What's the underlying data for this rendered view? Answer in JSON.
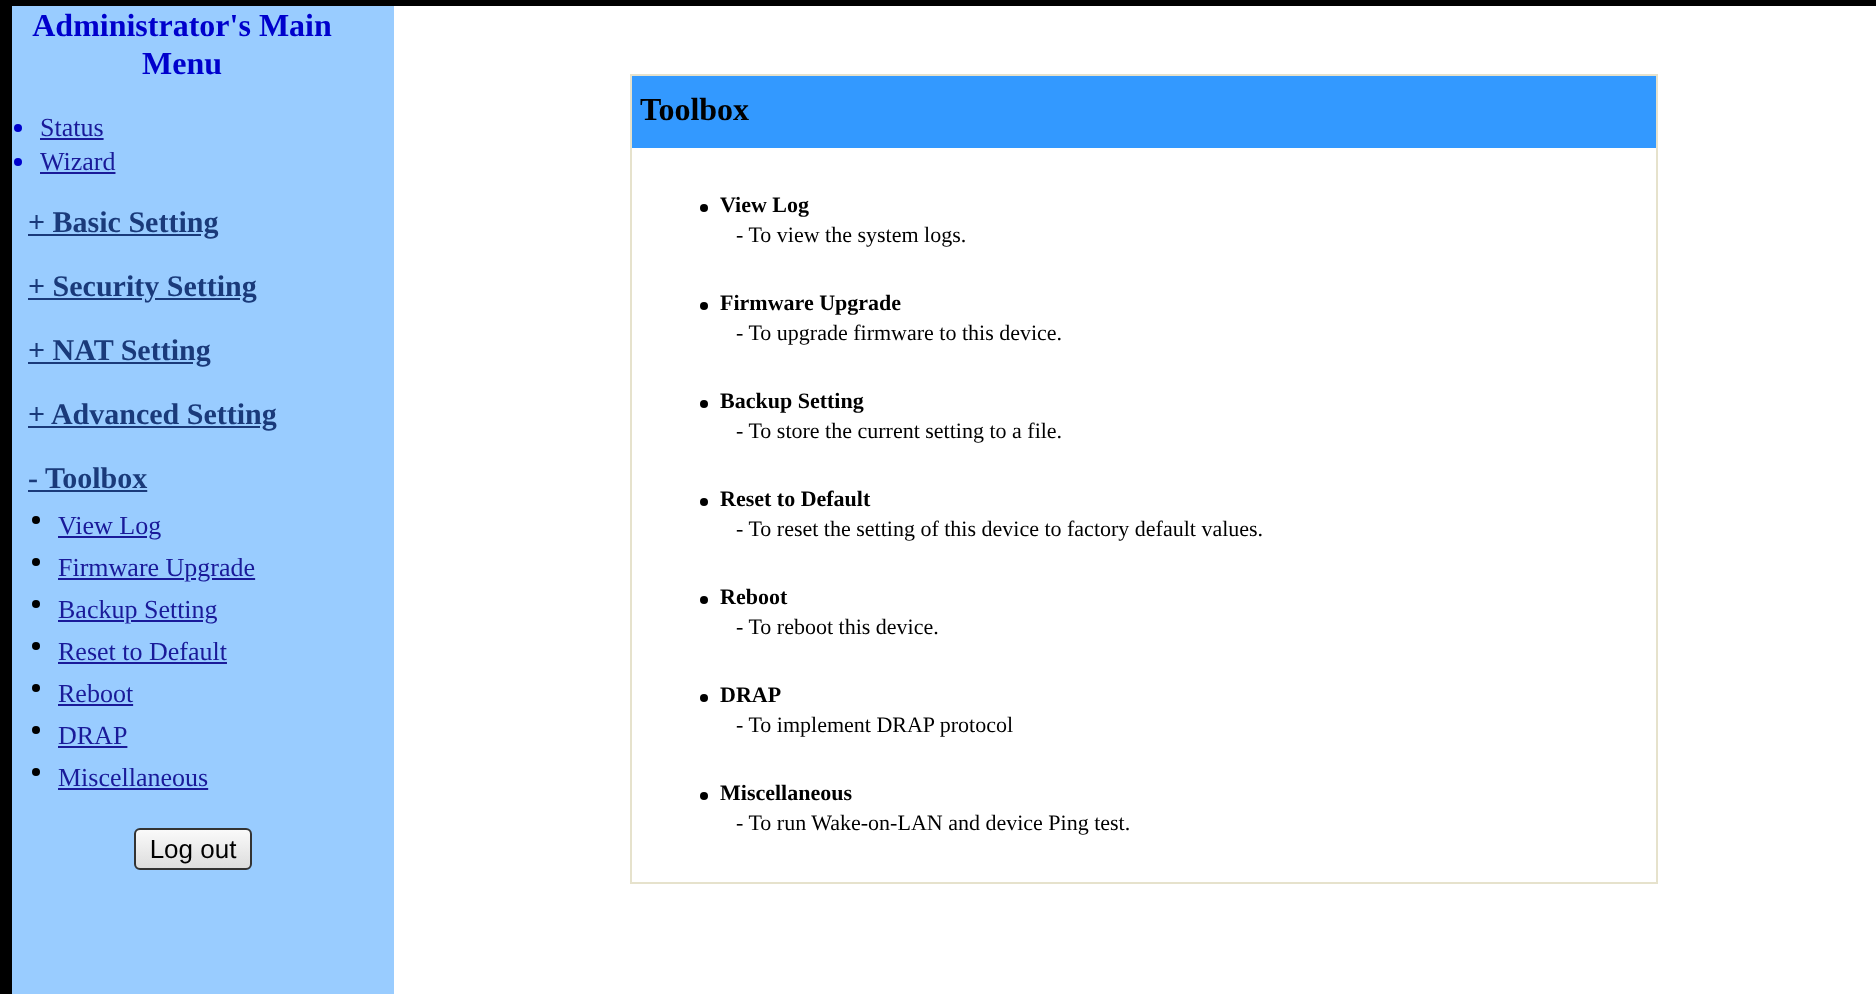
{
  "sidebar": {
    "title": "Administrator's Main Menu",
    "links": [
      {
        "label": "Status"
      },
      {
        "label": "Wizard"
      }
    ],
    "sections": [
      {
        "label": "+ Basic Setting"
      },
      {
        "label": "+ Security Setting"
      },
      {
        "label": "+ NAT Setting"
      },
      {
        "label": "+ Advanced Setting"
      },
      {
        "label": "- Toolbox",
        "children": [
          {
            "label": "View Log"
          },
          {
            "label": "Firmware Upgrade"
          },
          {
            "label": "Backup Setting"
          },
          {
            "label": "Reset to Default"
          },
          {
            "label": "Reboot"
          },
          {
            "label": "DRAP"
          },
          {
            "label": "Miscellaneous"
          }
        ]
      }
    ],
    "logout_button": "Log out"
  },
  "panel": {
    "title": "Toolbox",
    "items": [
      {
        "name": "View Log",
        "description": "- To view the system logs."
      },
      {
        "name": "Firmware Upgrade",
        "description": "- To upgrade firmware to this device."
      },
      {
        "name": "Backup Setting",
        "description": "- To store the current setting to a file."
      },
      {
        "name": "Reset to Default",
        "description": "- To reset the setting of this device to factory default values."
      },
      {
        "name": "Reboot",
        "description": "- To reboot this device."
      },
      {
        "name": "DRAP",
        "description": "- To implement DRAP protocol"
      },
      {
        "name": "Miscellaneous",
        "description": "- To run Wake-on-LAN and device Ping test."
      }
    ]
  }
}
